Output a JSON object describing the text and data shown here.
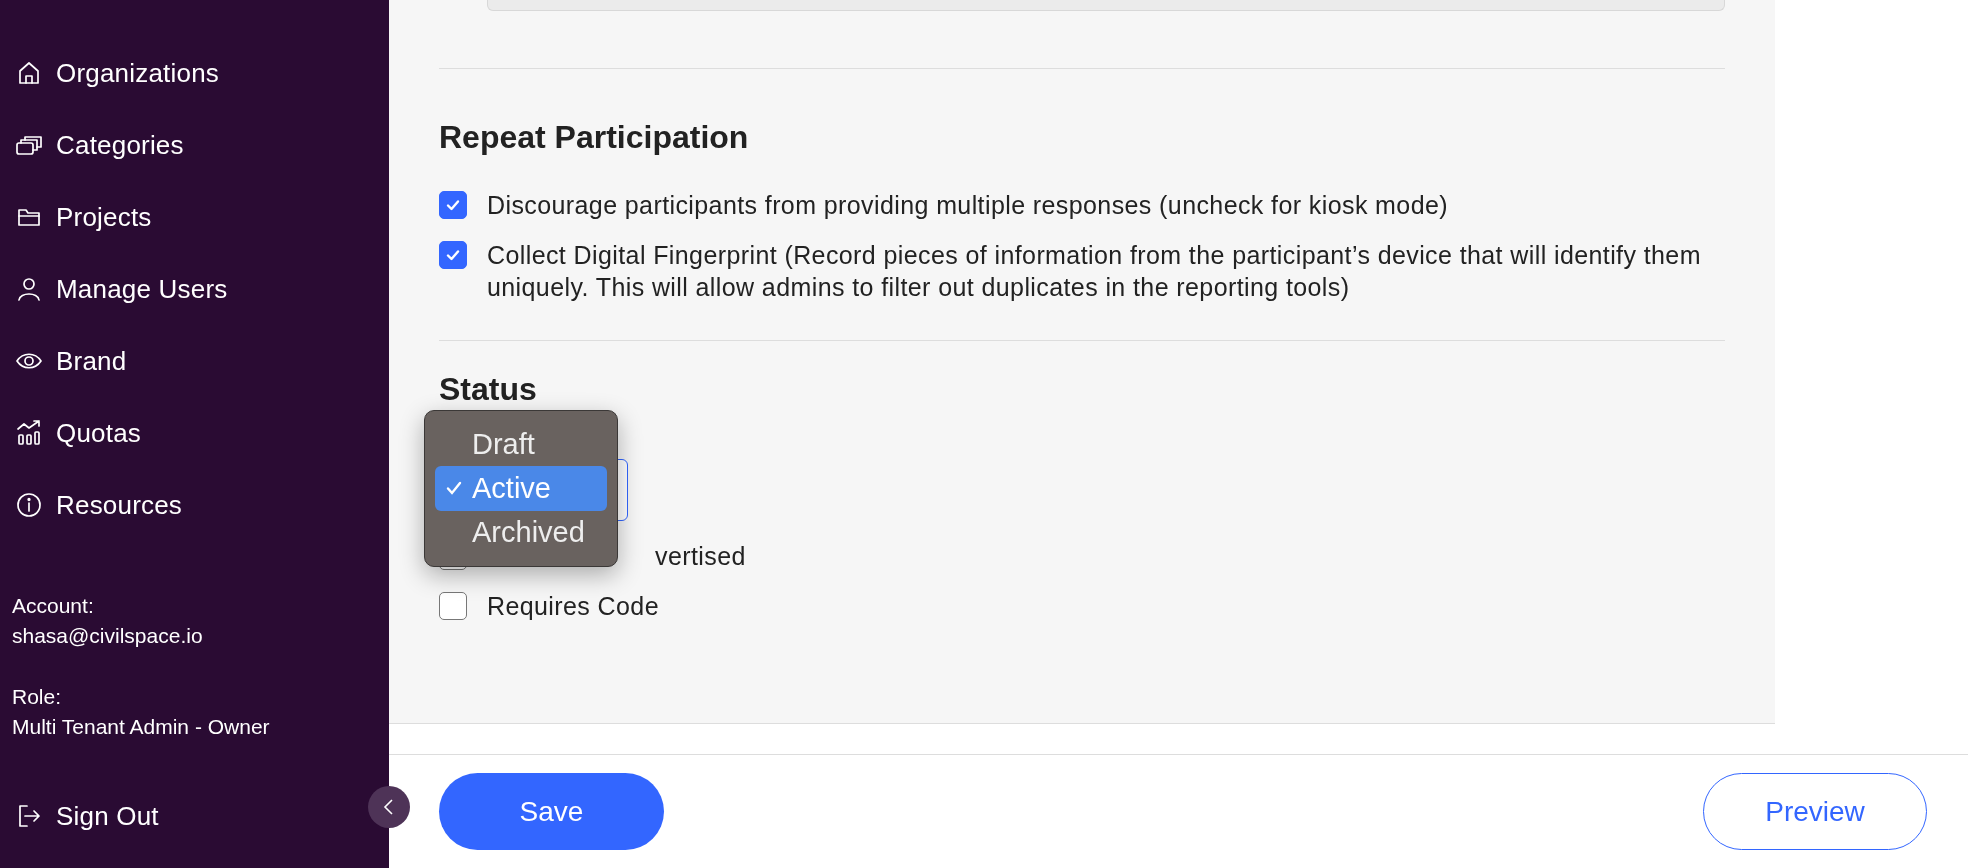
{
  "sidebar": {
    "items": [
      {
        "label": "Organizations"
      },
      {
        "label": "Categories"
      },
      {
        "label": "Projects"
      },
      {
        "label": "Manage Users"
      },
      {
        "label": "Brand"
      },
      {
        "label": "Quotas"
      },
      {
        "label": "Resources"
      }
    ],
    "account": {
      "label": "Account:",
      "value": "shasa@civilspace.io"
    },
    "role": {
      "label": "Role:",
      "value": "Multi Tenant Admin - Owner"
    },
    "sign_out": "Sign Out"
  },
  "repeat_participation": {
    "heading": "Repeat Participation",
    "options": [
      {
        "label": "Discourage participants from providing multiple responses (uncheck for kiosk mode)",
        "checked": true
      },
      {
        "label": "Collect Digital Fingerprint (Record pieces of information from the participant’s device that will identify them uniquely. This will allow admins to filter out duplicates in the reporting tools)",
        "checked": true
      }
    ]
  },
  "status": {
    "heading": "Status",
    "options": [
      {
        "label": "vertised",
        "checked": false
      },
      {
        "label": "Requires Code",
        "checked": false
      }
    ],
    "dropdown": [
      {
        "label": "Draft",
        "selected": false
      },
      {
        "label": "Active",
        "selected": true
      },
      {
        "label": "Archived",
        "selected": false
      }
    ]
  },
  "footer": {
    "save": "Save",
    "preview": "Preview"
  }
}
